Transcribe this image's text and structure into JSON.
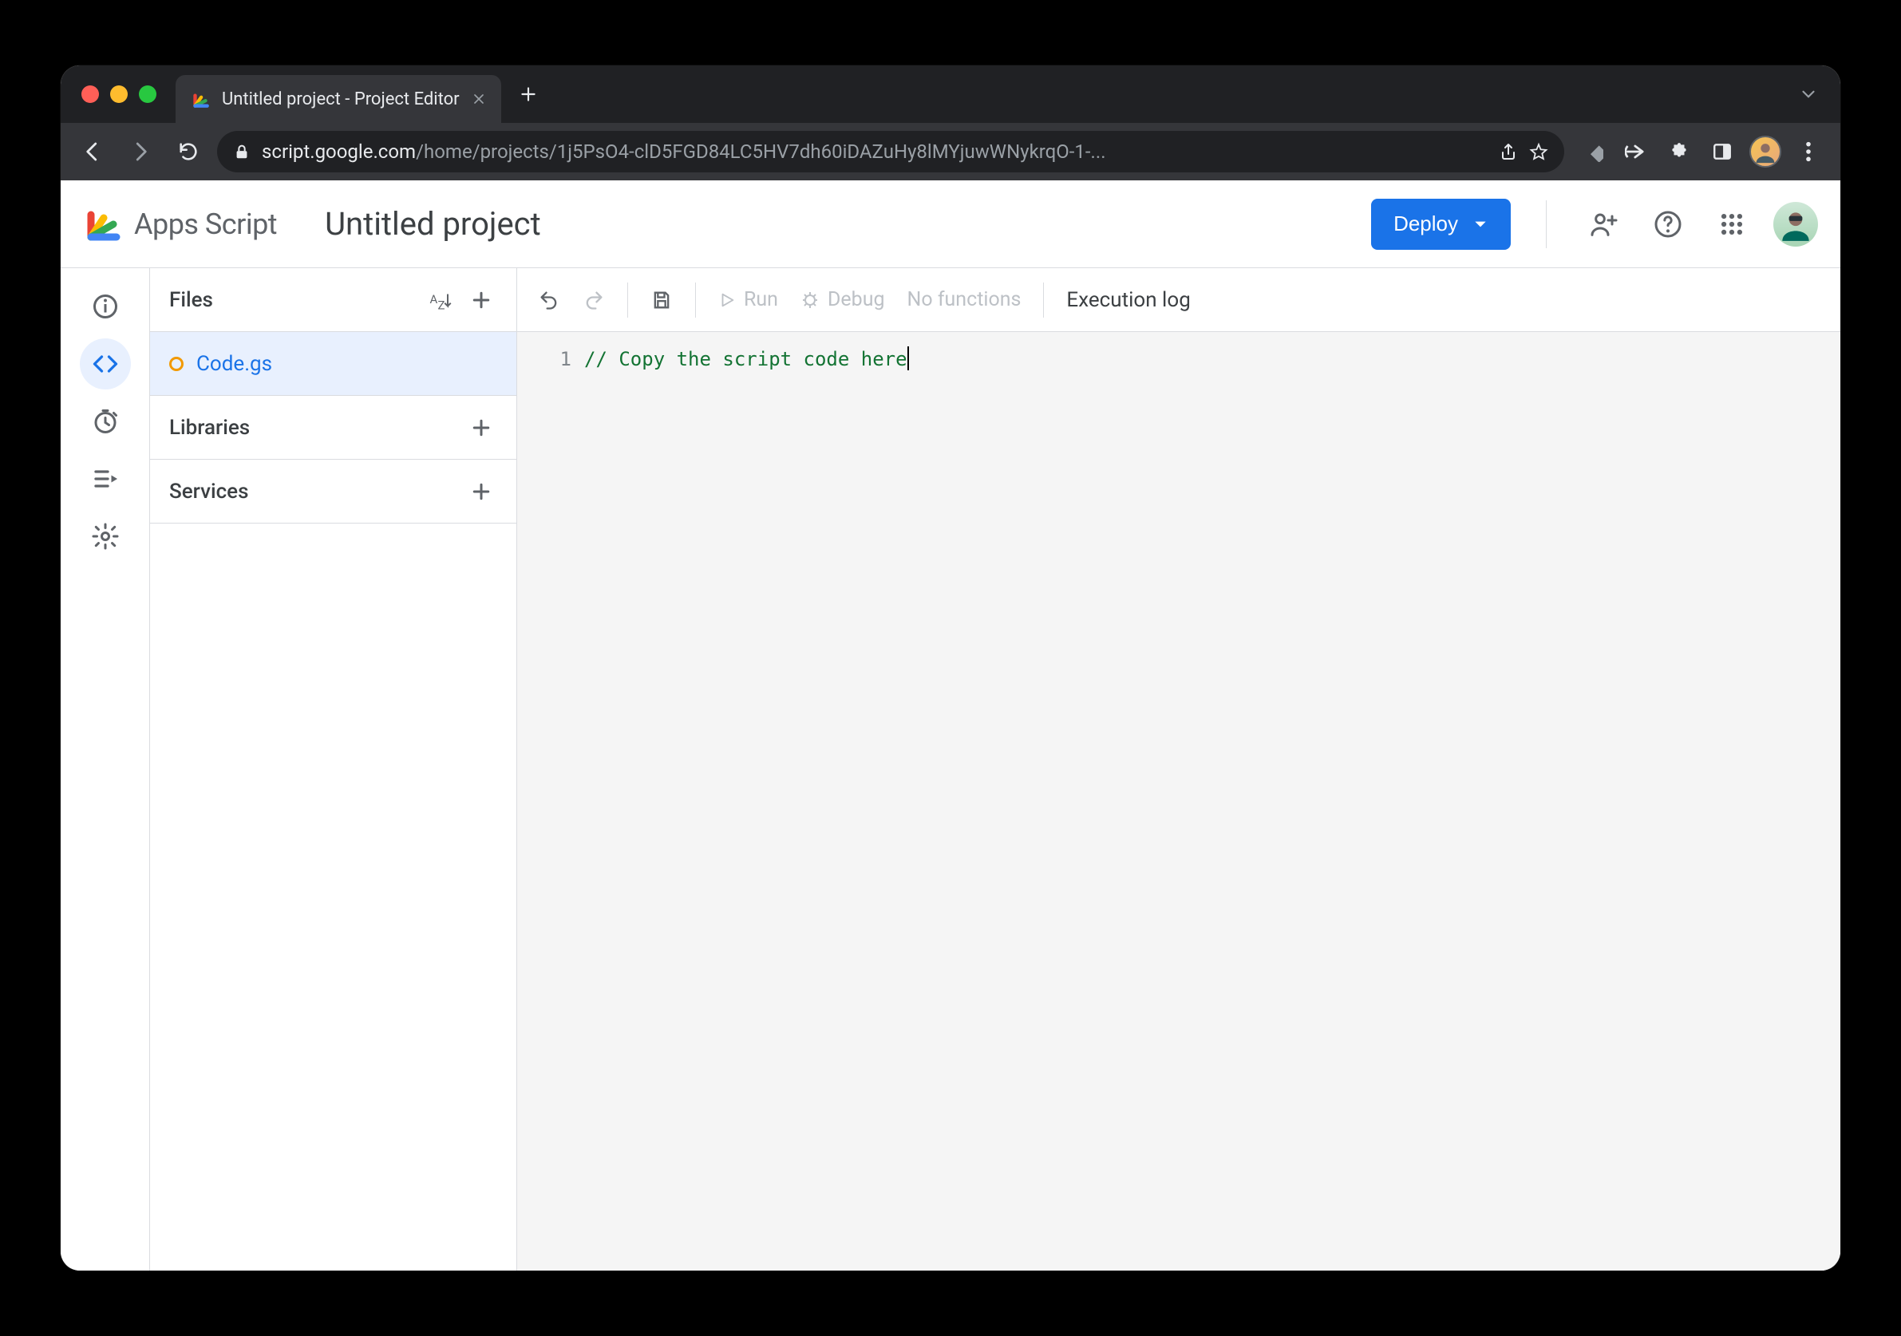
{
  "browser": {
    "tab_title": "Untitled project - Project Editor",
    "url_host": "script.google.com",
    "url_path": "/home/projects/1j5PsO4-clD5FGD84LC5HV7dh60iDAZuHy8lMYjuwWNykrqO-1-..."
  },
  "header": {
    "product_name": "Apps Script",
    "project_title": "Untitled project",
    "deploy_label": "Deploy"
  },
  "files_panel": {
    "files_heading": "Files",
    "libraries_heading": "Libraries",
    "services_heading": "Services",
    "items": [
      {
        "name": "Code.gs",
        "status": "unsaved"
      }
    ]
  },
  "toolbar": {
    "run_label": "Run",
    "debug_label": "Debug",
    "function_selector": "No functions",
    "execution_log_label": "Execution log"
  },
  "editor": {
    "lines": [
      {
        "number": "1",
        "text": "// Copy the script code here"
      }
    ]
  },
  "nav_rail": {
    "items": [
      "overview",
      "editor",
      "triggers",
      "executions",
      "settings"
    ]
  }
}
